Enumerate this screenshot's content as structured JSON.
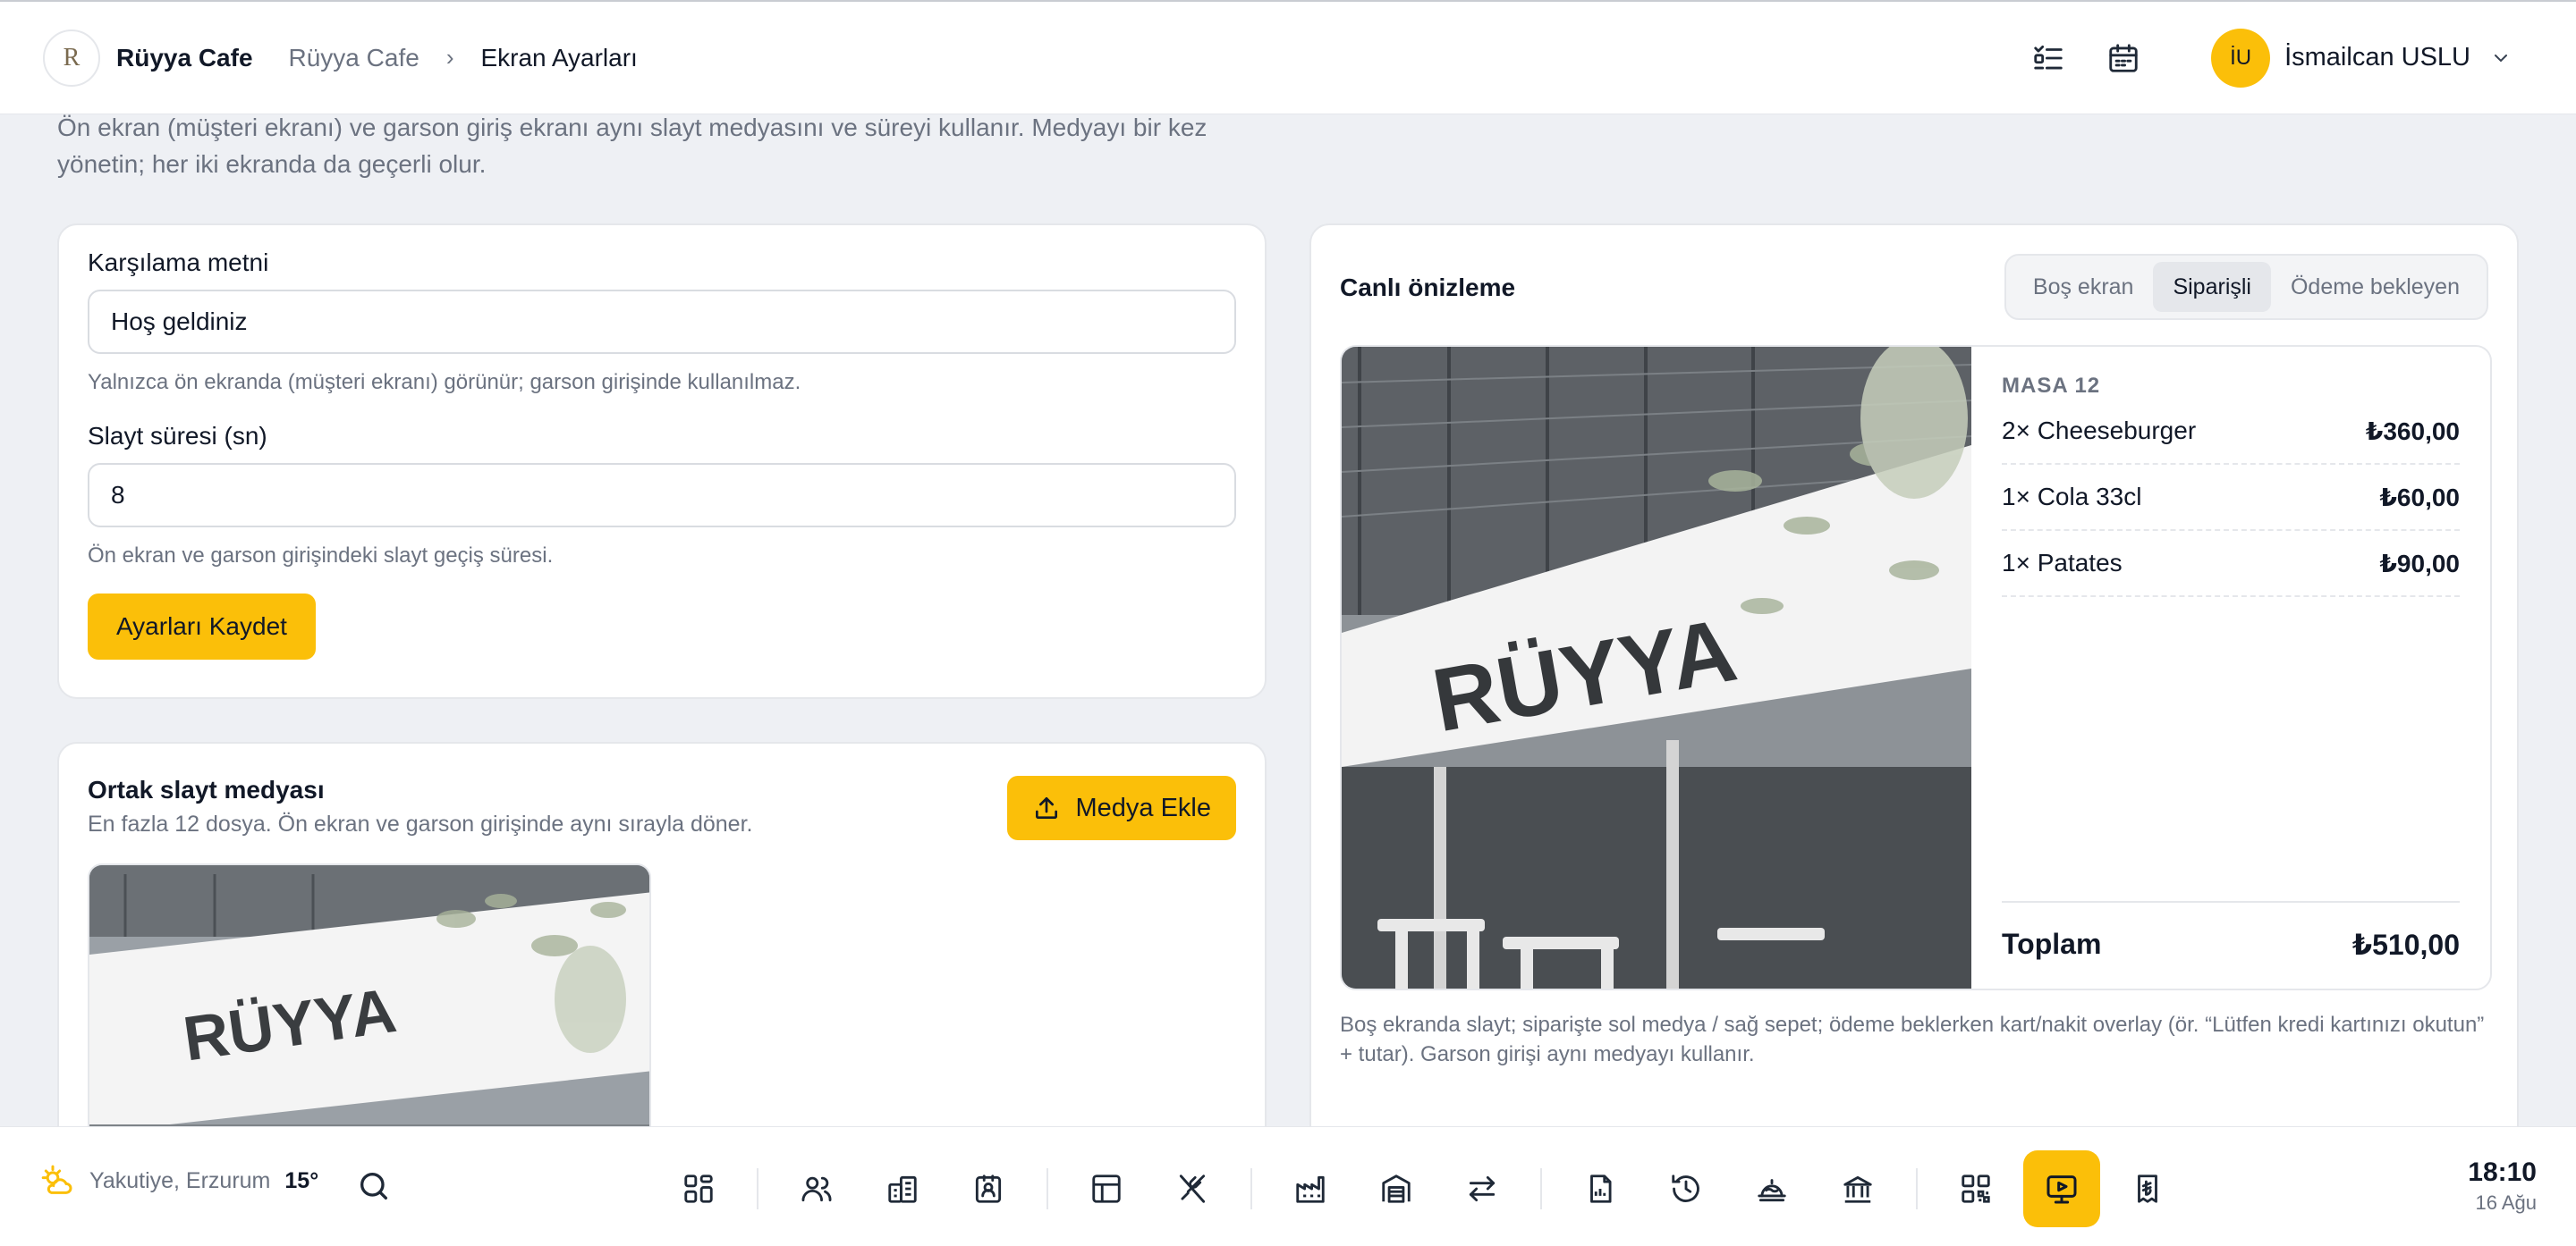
{
  "header": {
    "logo_text": "R",
    "brand": "Rüyya Cafe",
    "breadcrumb": [
      "Rüyya Cafe",
      "Ekran Ayarları"
    ],
    "user_initials": "İU",
    "user_name": "İsmailcan USLU"
  },
  "description": "Ön ekran (müşteri ekranı) ve garson giriş ekranı aynı slayt medyasını ve süreyi kullanır. Medyayı bir kez yönetin; her iki ekranda da geçerli olur.",
  "settings": {
    "welcome_label": "Karşılama metni",
    "welcome_value": "Hoş geldiniz",
    "welcome_help": "Yalnızca ön ekranda (müşteri ekranı) görünür; garson girişinde kullanılmaz.",
    "duration_label": "Slayt süresi (sn)",
    "duration_value": "8",
    "duration_help": "Ön ekran ve garson girişindeki slayt geçiş süresi.",
    "save_label": "Ayarları Kaydet"
  },
  "media": {
    "title": "Ortak slayt medyası",
    "subtitle": "En fazla 12 dosya. Ön ekran ve garson girişinde aynı sırayla döner.",
    "add_label": "Medya Ekle",
    "image_sign_text": "RÜYYA"
  },
  "preview": {
    "title": "Canlı önizleme",
    "tabs": [
      "Boş ekran",
      "Siparişli",
      "Ödeme bekleyen"
    ],
    "active_tab": "Siparişli",
    "table_label": "MASA 12",
    "items": [
      {
        "name": "2× Cheeseburger",
        "price": "₺360,00"
      },
      {
        "name": "1× Cola 33cl",
        "price": "₺60,00"
      },
      {
        "name": "1× Patates",
        "price": "₺90,00"
      }
    ],
    "total_label": "Toplam",
    "total_value": "₺510,00",
    "note": "Boş ekranda slayt; siparişte sol medya / sağ sepet; ödeme beklerken kart/nakit overlay (ör. “Lütfen kredi kartınızı okutun” + tutar). Garson girişi aynı medyayı kullanır."
  },
  "dock": {
    "weather_location": "Yakutiye, Erzurum",
    "weather_temp": "15°",
    "time": "18:10",
    "date": "16 Ağu",
    "active_icon": "screen-settings-icon",
    "accent_color": "#fbbf09"
  }
}
